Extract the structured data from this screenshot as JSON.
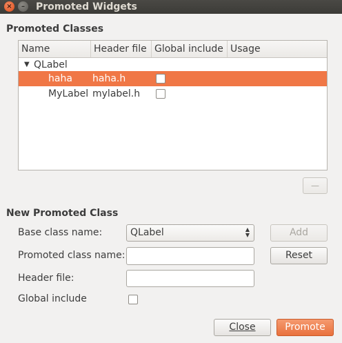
{
  "window": {
    "title": "Promoted Widgets",
    "close_glyph": "×",
    "minimize_glyph": "–"
  },
  "promoted_classes": {
    "section_title": "Promoted Classes",
    "columns": [
      "Name",
      "Header file",
      "Global include",
      "Usage"
    ],
    "groups": [
      {
        "expander_glyph": "▼",
        "name": "QLabel",
        "items": [
          {
            "name": "haha",
            "header": "haha.h",
            "global_include": false,
            "usage": "",
            "selected": true
          },
          {
            "name": "MyLabel",
            "header": "mylabel.h",
            "global_include": false,
            "usage": "",
            "selected": false
          }
        ]
      }
    ],
    "remove_button_glyph": "—"
  },
  "new_promoted_class": {
    "section_title": "New Promoted Class",
    "base_class_label": "Base class name:",
    "base_class_value": "QLabel",
    "base_class_arrows": [
      "▲",
      "▼"
    ],
    "promoted_class_label": "Promoted class name:",
    "promoted_class_value": "",
    "header_file_label": "Header file:",
    "header_file_value": "",
    "global_include_label": "Global include",
    "global_include_checked": false,
    "add_label": "Add",
    "reset_label": "Reset"
  },
  "footer": {
    "close_label": "Close",
    "promote_label": "Promote"
  },
  "colors": {
    "selection": "#f07746",
    "accent_button": "#e9713d",
    "titlebar": "#3c3b37"
  }
}
